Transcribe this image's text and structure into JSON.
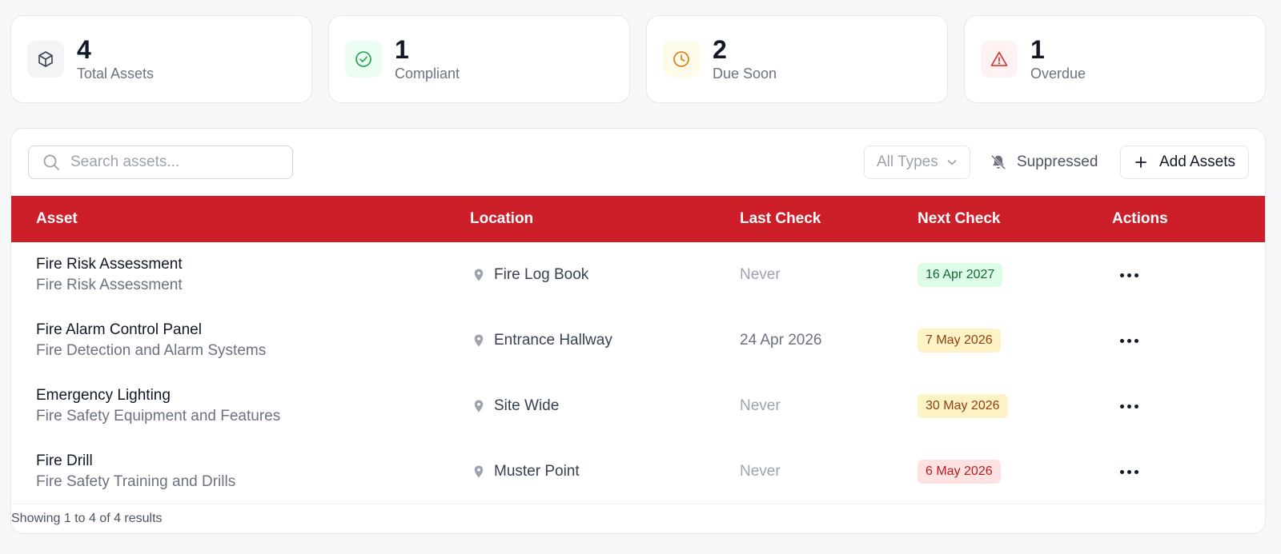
{
  "stats": [
    {
      "value": "4",
      "label": "Total Assets",
      "icon": "box-icon",
      "color": "#374151",
      "bg": "#f3f4f6"
    },
    {
      "value": "1",
      "label": "Compliant",
      "icon": "check-circle-icon",
      "color": "#16a34a",
      "bg": "#ecfdf3"
    },
    {
      "value": "2",
      "label": "Due Soon",
      "icon": "clock-icon",
      "color": "#d97706",
      "bg": "#fffbeb"
    },
    {
      "value": "1",
      "label": "Overdue",
      "icon": "warning-triangle-icon",
      "color": "#dc2626",
      "bg": "#fef2f2"
    }
  ],
  "toolbar": {
    "search_placeholder": "Search assets...",
    "type_filter": "All Types",
    "suppressed_label": "Suppressed",
    "add_label": "Add Assets"
  },
  "table": {
    "headers": [
      "Asset",
      "Location",
      "Last Check",
      "Next Check",
      "Actions"
    ],
    "rows": [
      {
        "name": "Fire Risk Assessment",
        "type": "Fire Risk Assessment",
        "location": "Fire Log Book",
        "last_check": "Never",
        "next_check": "16 Apr 2027",
        "status": "green"
      },
      {
        "name": "Fire Alarm Control Panel",
        "type": "Fire Detection and Alarm Systems",
        "location": "Entrance Hallway",
        "last_check": "24 Apr 2026",
        "next_check": "7 May 2026",
        "status": "yellow"
      },
      {
        "name": "Emergency Lighting",
        "type": "Fire Safety Equipment and Features",
        "location": "Site Wide",
        "last_check": "Never",
        "next_check": "30 May 2026",
        "status": "yellow"
      },
      {
        "name": "Fire Drill",
        "type": "Fire Safety Training and Drills",
        "location": "Muster Point",
        "last_check": "Never",
        "next_check": "6 May 2026",
        "status": "red"
      }
    ]
  },
  "footer": {
    "text": "Showing 1 to 4 of 4 results"
  },
  "colors": {
    "header_bg": "#cd1f29"
  }
}
